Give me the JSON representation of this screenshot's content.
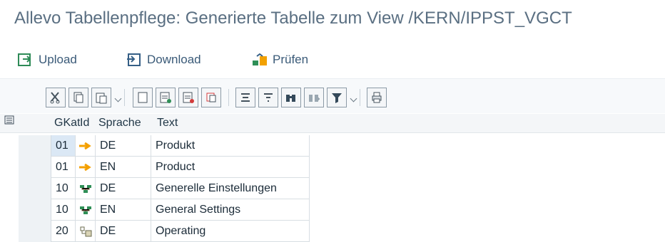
{
  "window": {
    "title": "Allevo Tabellenpflege: Generierte Tabelle zum View /KERN/IPPST_VGCT"
  },
  "app_toolbar": {
    "upload_label": "Upload",
    "download_label": "Download",
    "check_label": "Prüfen"
  },
  "grid_toolbar": {
    "buttons": [
      {
        "icon": "cut-icon"
      },
      {
        "icon": "copy-icon"
      },
      {
        "icon": "paste-icon"
      },
      {
        "icon": "new-row-icon"
      },
      {
        "icon": "insert-row-icon"
      },
      {
        "icon": "delete-row-icon"
      },
      {
        "icon": "duplicate-row-icon"
      },
      {
        "icon": "sort-ascending-icon"
      },
      {
        "icon": "sort-descending-icon"
      },
      {
        "icon": "find-icon"
      },
      {
        "icon": "find-next-icon"
      },
      {
        "icon": "filter-icon"
      },
      {
        "icon": "print-icon"
      }
    ]
  },
  "table": {
    "columns": [
      "GKat",
      "Id",
      "Sprache",
      "Text"
    ],
    "rows": [
      {
        "gkat": "01",
        "id_icon": "arrow-right-icon",
        "sprache": "DE",
        "text": "Produkt"
      },
      {
        "gkat": "01",
        "id_icon": "arrow-right-icon",
        "sprache": "EN",
        "text": "Product"
      },
      {
        "gkat": "10",
        "id_icon": "settings-group-icon",
        "sprache": "DE",
        "text": "Generelle Einstellungen"
      },
      {
        "gkat": "10",
        "id_icon": "settings-group-icon",
        "sprache": "EN",
        "text": "General Settings"
      },
      {
        "gkat": "20",
        "id_icon": "operating-icon",
        "sprache": "DE",
        "text": "Operating"
      }
    ]
  },
  "colors": {
    "title": "#5a6f82",
    "action_text": "#3a5a78",
    "selection": "#dbe8f5",
    "arrow": "#f4a000",
    "green": "#2f8f57"
  }
}
